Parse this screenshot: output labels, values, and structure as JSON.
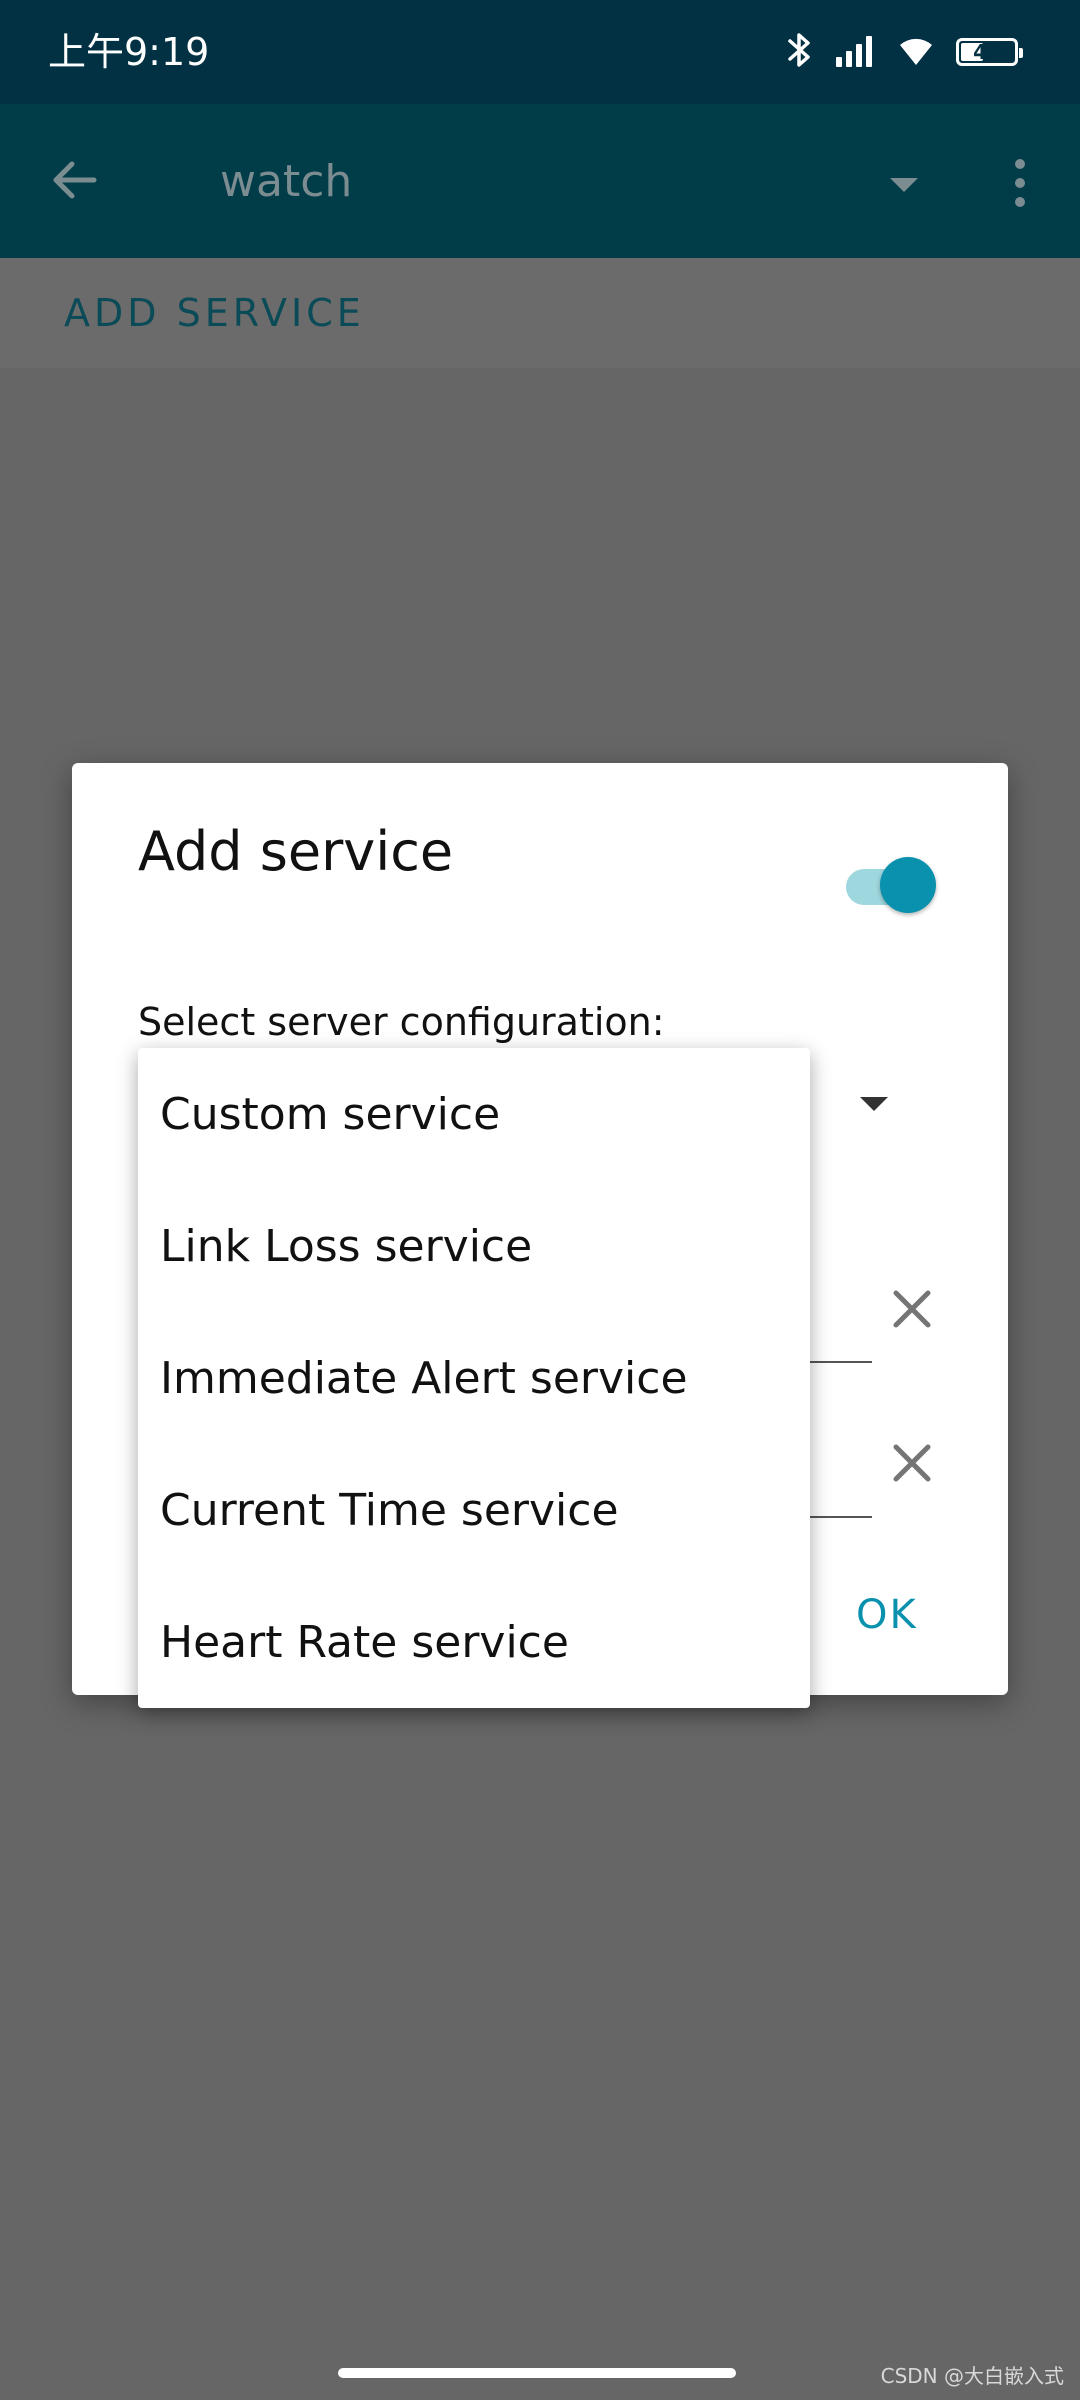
{
  "status_bar": {
    "time": "上午9:19",
    "battery_level": "47",
    "battery_fraction": 0.47
  },
  "toolbar": {
    "title": "watch",
    "back_icon": "arrow-left-icon",
    "dropdown_icon": "caret-down-icon",
    "overflow_icon": "more-vert-icon"
  },
  "action_strip": {
    "add_service_label": "ADD SERVICE"
  },
  "dialog": {
    "title": "Add service",
    "toggle_on": true,
    "config_label": "Select server configuration:",
    "ok_label": "OK"
  },
  "dropdown": {
    "items": [
      {
        "label": "Custom service"
      },
      {
        "label": "Link Loss service"
      },
      {
        "label": "Immediate Alert service"
      },
      {
        "label": "Current Time service"
      },
      {
        "label": "Heart Rate service"
      }
    ]
  },
  "watermark": "CSDN @大白嵌入式",
  "colors": {
    "status_bar_bg": "#013142",
    "toolbar_bg": "#013c49",
    "accent": "#0a91ad",
    "scrim": "#666666"
  }
}
